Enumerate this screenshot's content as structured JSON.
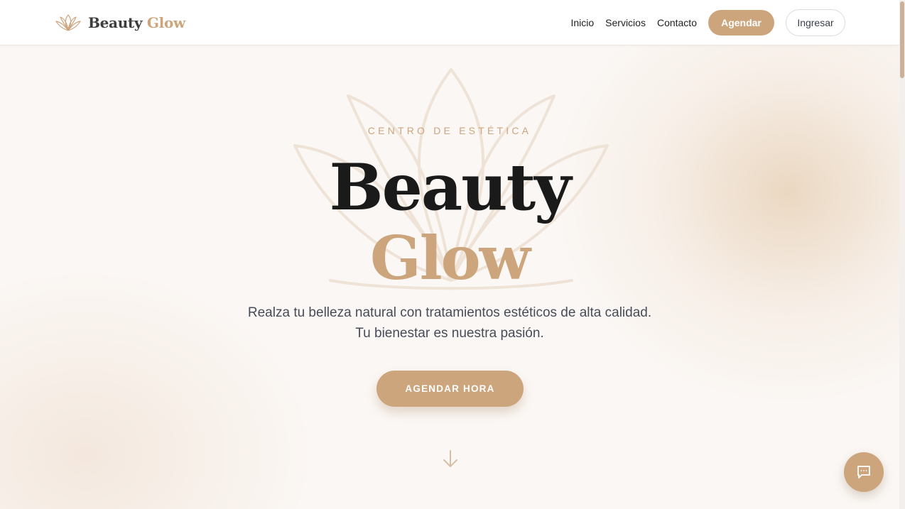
{
  "brand": {
    "name_part1": "Beauty",
    "name_part2": "Glow",
    "icon": "lotus-icon",
    "accent_color": "#cca57d"
  },
  "nav": {
    "links": [
      "Inicio",
      "Servicios",
      "Contacto"
    ],
    "primary_button": "Agendar",
    "secondary_button": "Ingresar"
  },
  "hero": {
    "eyebrow": "CENTRO DE ESTÉTICA",
    "title_line1": "Beauty",
    "title_line2": "Glow",
    "subtitle_line1": "Realza tu belleza natural con tratamientos estéticos de alta calidad.",
    "subtitle_line2": "Tu bienestar es nuestra pasión.",
    "cta": "AGENDAR HORA",
    "scroll_icon": "arrow-down-icon"
  },
  "chat_widget": {
    "icon": "chat-bubble-icon"
  }
}
